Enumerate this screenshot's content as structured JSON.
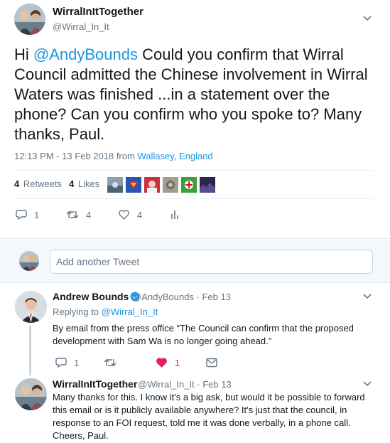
{
  "tweet": {
    "author_name": "WirralInItTogether",
    "author_handle": "@Wirral_In_It",
    "text_prefix": "Hi ",
    "text_mention": "@AndyBounds",
    "text_body": " Could you confirm that Wirral Council admitted the Chinese involvement in Wirral Waters was finished ...in a statement over the phone? Can you confirm who you spoke to? Many thanks, Paul.",
    "timestamp": "12:13 PM - 13 Feb 2018 from ",
    "location": "Wallasey, England",
    "retweets_count": "4",
    "retweets_label": "Retweets",
    "likes_count": "4",
    "likes_label": "Likes",
    "actions": {
      "reply_count": "1",
      "retweet_count": "4",
      "like_count": "4"
    }
  },
  "compose": {
    "placeholder": "Add another Tweet"
  },
  "replies": [
    {
      "name": "Andrew Bounds",
      "handle": "@AndyBounds",
      "date": "· Feb 13",
      "replying_to_label": "Replying to ",
      "replying_to_handle": "@Wirral_In_It",
      "text": "By email from the press office “The Council can confirm that the proposed development with Sam Wa is no longer going ahead.”",
      "reply_count": "1",
      "like_count": "1"
    },
    {
      "name": "WirralInItTogether",
      "handle": "@Wirral_In_It",
      "date": "· Feb 13",
      "text": "Many thanks for this.  I know it's a big ask, but would it be possible to forward this email or is it publicly available anywhere?   It's just that the council, in response to an FOI request, told me it was done verbally, in a phone call. Cheers, Paul."
    }
  ],
  "colors": {
    "link": "#1b95e0",
    "secondary_text": "#657786",
    "like_active": "#e0245e",
    "border": "#e6ecf0"
  }
}
